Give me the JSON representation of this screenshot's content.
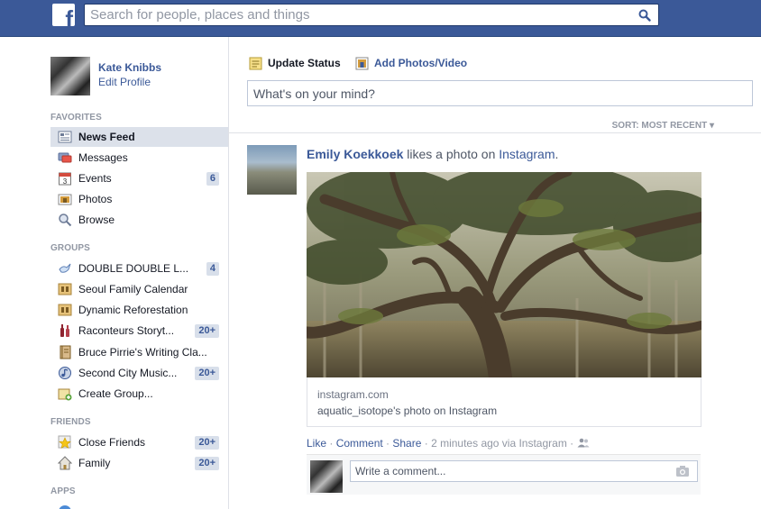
{
  "colors": {
    "brand": "#3b5998",
    "badge_bg": "#d8dfea",
    "selected_bg": "#dce1ea"
  },
  "header": {
    "logo_letter": "f",
    "search_placeholder": "Search for people, places and things"
  },
  "profile": {
    "name": "Kate Knibbs",
    "edit_label": "Edit Profile"
  },
  "favorites": {
    "heading": "FAVORITES",
    "items": [
      {
        "label": "News Feed",
        "icon": "news-feed-icon",
        "selected": true
      },
      {
        "label": "Messages",
        "icon": "messages-icon"
      },
      {
        "label": "Events",
        "icon": "calendar-icon",
        "badge": "6"
      },
      {
        "label": "Photos",
        "icon": "photos-icon"
      },
      {
        "label": "Browse",
        "icon": "search-icon"
      }
    ]
  },
  "groups": {
    "heading": "GROUPS",
    "items": [
      {
        "label": "DOUBLE DOUBLE L...",
        "icon": "dove-icon",
        "badge": "4"
      },
      {
        "label": "Seoul Family Calendar",
        "icon": "group-icon"
      },
      {
        "label": "Dynamic Reforestation",
        "icon": "group-icon"
      },
      {
        "label": "Raconteurs Storyt...",
        "icon": "wine-icon",
        "badge": "20+"
      },
      {
        "label": "Bruce Pirrie's Writing Cla...",
        "icon": "notebook-icon"
      },
      {
        "label": "Second City Music...",
        "icon": "music-icon",
        "badge": "20+"
      },
      {
        "label": "Create Group...",
        "icon": "create-group-icon"
      }
    ]
  },
  "friends": {
    "heading": "FRIENDS",
    "items": [
      {
        "label": "Close Friends",
        "icon": "star-icon",
        "badge": "20+"
      },
      {
        "label": "Family",
        "icon": "house-icon",
        "badge": "20+"
      }
    ]
  },
  "apps": {
    "heading": "APPS"
  },
  "composer": {
    "update_status": "Update Status",
    "add_photos": "Add Photos/Video",
    "placeholder": "What's on your mind?"
  },
  "feed": {
    "sort_label": "SORT: MOST RECENT"
  },
  "story": {
    "actor": "Emily Koekkoek",
    "verb": " likes a photo on ",
    "target": "Instagram",
    "end": ".",
    "domain": "instagram.com",
    "title": "aquatic_isotope's photo on Instagram",
    "like": "Like",
    "comment": "Comment",
    "share": "Share",
    "sep": " · ",
    "time": "2 minutes ago via Instagram",
    "comment_placeholder": "Write a comment..."
  }
}
